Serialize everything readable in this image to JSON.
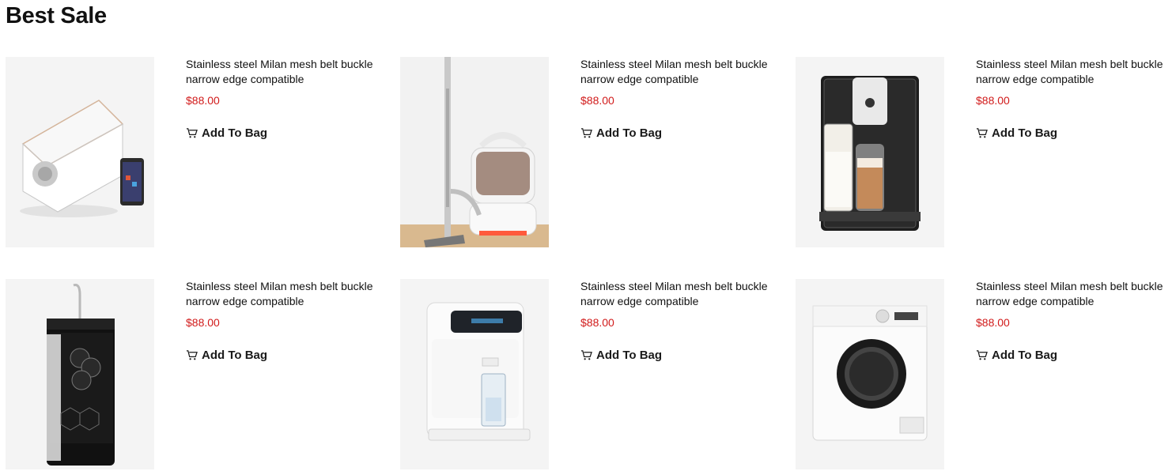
{
  "section": {
    "title": "Best Sale"
  },
  "products": [
    {
      "title": "Stainless steel Milan mesh belt buckle narrow edge compatible",
      "price": "$88.00",
      "cta": "Add To Bag",
      "image": "robot-vacuum"
    },
    {
      "title": "Stainless steel Milan mesh belt buckle narrow edge compatible",
      "price": "$88.00",
      "cta": "Add To Bag",
      "image": "canister-vacuum"
    },
    {
      "title": "Stainless steel Milan mesh belt buckle narrow edge compatible",
      "price": "$88.00",
      "cta": "Add To Bag",
      "image": "espresso-machine"
    },
    {
      "title": "Stainless steel Milan mesh belt buckle narrow edge compatible",
      "price": "$88.00",
      "cta": "Add To Bag",
      "image": "water-purifier"
    },
    {
      "title": "Stainless steel Milan mesh belt buckle narrow edge compatible",
      "price": "$88.00",
      "cta": "Add To Bag",
      "image": "water-dispenser"
    },
    {
      "title": "Stainless steel Milan mesh belt buckle narrow edge compatible",
      "price": "$88.00",
      "cta": "Add To Bag",
      "image": "washing-machine"
    }
  ],
  "colors": {
    "price": "#d11a1a",
    "thumb_bg": "#f4f4f4"
  }
}
